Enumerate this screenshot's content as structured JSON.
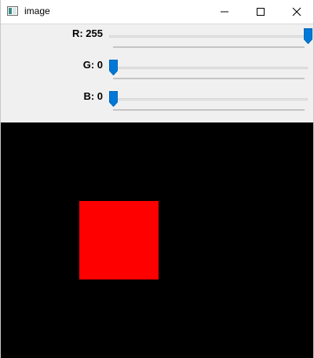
{
  "window": {
    "title": "image",
    "icon": "opencv-window-icon",
    "controls": [
      "minimize-icon",
      "maximize-icon",
      "close-icon"
    ]
  },
  "trackbars": [
    {
      "label": "R: 255",
      "channel": "R",
      "value": 255,
      "min": 0,
      "max": 255
    },
    {
      "label": "G: 0",
      "channel": "G",
      "value": 0,
      "min": 0,
      "max": 255
    },
    {
      "label": "B: 0",
      "channel": "B",
      "value": 0,
      "min": 0,
      "max": 255
    }
  ],
  "colors": {
    "thumb": "#0078d7",
    "canvas_background": "#000000",
    "square_fill": "#ff0000"
  }
}
